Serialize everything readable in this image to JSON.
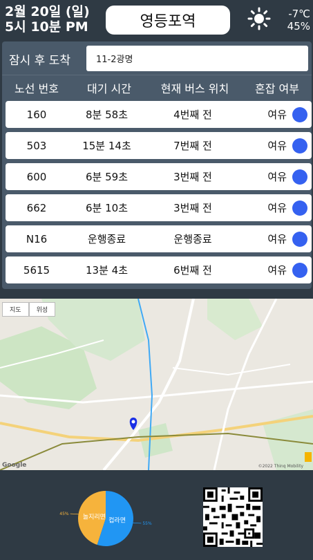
{
  "header": {
    "date": "2월 20일 (일)",
    "time": "5시 10분 PM",
    "station": "영등포역",
    "weather_icon": "sun-icon",
    "temperature": "-7℃",
    "humidity": "45%"
  },
  "arrival": {
    "label": "잠시 후 도착",
    "value": "11-2광명"
  },
  "table": {
    "headers": [
      "노선 번호",
      "대기 시간",
      "현재 버스 위치",
      "혼잡 여부"
    ],
    "rows": [
      {
        "route": "160",
        "wait": "8분 58초",
        "location": "4번째 전",
        "crowd": "여유"
      },
      {
        "route": "503",
        "wait": "15분 14초",
        "location": "7번째 전",
        "crowd": "여유"
      },
      {
        "route": "600",
        "wait": "6분 59초",
        "location": "3번째 전",
        "crowd": "여유"
      },
      {
        "route": "662",
        "wait": "6분 10초",
        "location": "3번째 전",
        "crowd": "여유"
      },
      {
        "route": "N16",
        "wait": "운행종료",
        "location": "운행종료",
        "crowd": "여유"
      },
      {
        "route": "5615",
        "wait": "13분 4초",
        "location": "6번째 전",
        "crowd": "여유"
      }
    ],
    "status_color": "#3561f0"
  },
  "map": {
    "tabs": [
      "지도",
      "위성"
    ],
    "logo": "Google",
    "attribution": "©2022 Thinq Mobility"
  },
  "chart_data": {
    "type": "pie",
    "series": [
      {
        "name": "놀지리면",
        "value": 45,
        "label": "45%",
        "color": "#f6b33c"
      },
      {
        "name": "컵라면",
        "value": 55,
        "label": "55%",
        "color": "#2196f3"
      }
    ]
  }
}
